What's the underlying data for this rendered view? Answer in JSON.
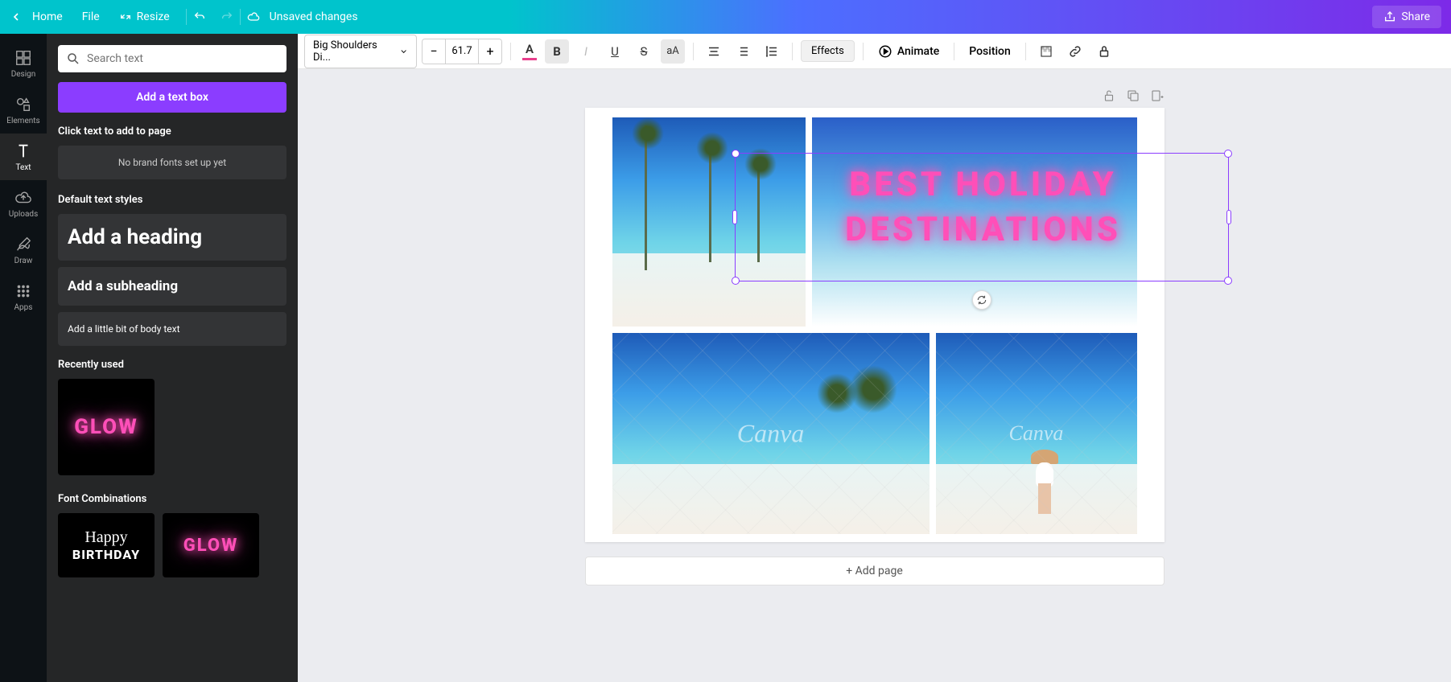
{
  "topbar": {
    "home": "Home",
    "file": "File",
    "resize": "Resize",
    "unsaved": "Unsaved changes",
    "share": "Share"
  },
  "rail": {
    "design": "Design",
    "elements": "Elements",
    "text": "Text",
    "uploads": "Uploads",
    "draw": "Draw",
    "apps": "Apps"
  },
  "sidepanel": {
    "search_placeholder": "Search text",
    "add_text_box": "Add a text box",
    "click_to_add": "Click text to add to page",
    "no_brand_fonts": "No brand fonts set up yet",
    "default_styles": "Default text styles",
    "heading": "Add a heading",
    "subheading": "Add a subheading",
    "body": "Add a little bit of body text",
    "recently_used": "Recently used",
    "glow": "GLOW",
    "font_combinations": "Font Combinations",
    "happy": "Happy",
    "birthday": "BIRTHDAY",
    "glow2": "GLOW"
  },
  "editorbar": {
    "font": "Big Shoulders Di...",
    "size": "61.7",
    "effects": "Effects",
    "animate": "Animate",
    "position": "Position"
  },
  "canvas": {
    "text_line1": "BEST HOLIDAY",
    "text_line2": "DESTINATIONS",
    "watermark": "Canva",
    "add_page": "+ Add page"
  }
}
